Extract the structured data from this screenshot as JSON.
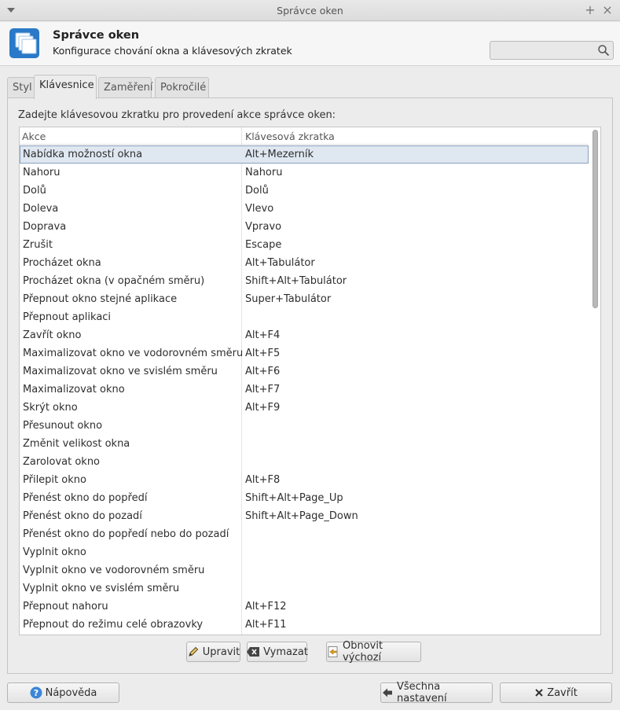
{
  "window": {
    "title": "Správce oken",
    "pin_glyph": "+",
    "close_glyph": "×"
  },
  "header": {
    "title": "Správce oken",
    "subtitle": "Konfigurace chování okna a klávesových zkratek",
    "search_placeholder": ""
  },
  "tabs": [
    {
      "label": "Styl",
      "active": false
    },
    {
      "label": "Klávesnice",
      "active": true
    },
    {
      "label": "Zaměření",
      "active": false
    },
    {
      "label": "Pokročilé",
      "active": false
    }
  ],
  "keyboard": {
    "instruction": "Zadejte klávesovou zkratku pro provedení akce správce oken:",
    "columns": {
      "action": "Akce",
      "shortcut": "Klávesová zkratka"
    },
    "rows": [
      {
        "action": "Nabídka možností okna",
        "shortcut": "Alt+Mezerník",
        "selected": true
      },
      {
        "action": "Nahoru",
        "shortcut": "Nahoru"
      },
      {
        "action": "Dolů",
        "shortcut": "Dolů"
      },
      {
        "action": "Doleva",
        "shortcut": "Vlevo"
      },
      {
        "action": "Doprava",
        "shortcut": "Vpravo"
      },
      {
        "action": "Zrušit",
        "shortcut": "Escape"
      },
      {
        "action": "Procházet okna",
        "shortcut": "Alt+Tabulátor"
      },
      {
        "action": "Procházet okna (v opačném směru)",
        "shortcut": "Shift+Alt+Tabulátor"
      },
      {
        "action": "Přepnout okno stejné aplikace",
        "shortcut": "Super+Tabulátor"
      },
      {
        "action": "Přepnout aplikaci",
        "shortcut": ""
      },
      {
        "action": "Zavřít okno",
        "shortcut": "Alt+F4"
      },
      {
        "action": "Maximalizovat okno ve vodorovném směru",
        "shortcut": "Alt+F5"
      },
      {
        "action": "Maximalizovat okno ve svislém směru",
        "shortcut": "Alt+F6"
      },
      {
        "action": "Maximalizovat okno",
        "shortcut": "Alt+F7"
      },
      {
        "action": "Skrýt okno",
        "shortcut": "Alt+F9"
      },
      {
        "action": "Přesunout okno",
        "shortcut": ""
      },
      {
        "action": "Změnit velikost okna",
        "shortcut": ""
      },
      {
        "action": "Zarolovat okno",
        "shortcut": ""
      },
      {
        "action": "Přilepit okno",
        "shortcut": "Alt+F8"
      },
      {
        "action": "Přenést okno do popředí",
        "shortcut": "Shift+Alt+Page_Up"
      },
      {
        "action": "Přenést okno do pozadí",
        "shortcut": "Shift+Alt+Page_Down"
      },
      {
        "action": "Přenést okno do popředí nebo do pozadí",
        "shortcut": ""
      },
      {
        "action": "Vyplnit okno",
        "shortcut": ""
      },
      {
        "action": "Vyplnit okno ve vodorovném směru",
        "shortcut": ""
      },
      {
        "action": "Vyplnit okno ve svislém směru",
        "shortcut": ""
      },
      {
        "action": "Přepnout nahoru",
        "shortcut": "Alt+F12"
      },
      {
        "action": "Přepnout do režimu celé obrazovky",
        "shortcut": "Alt+F11"
      }
    ],
    "buttons": {
      "edit": "Upravit",
      "clear": "Vymazat",
      "reset": "Obnovit výchozí"
    }
  },
  "footer": {
    "help": "Nápověda",
    "all_settings": "Všechna nastavení",
    "close": "Zavřít"
  },
  "colors": {
    "selection_bg": "#dfe7f1",
    "selection_border": "#8aa1c0",
    "icon_blue": "#2a79c8"
  },
  "icons": {
    "app": "window-manager-icon",
    "search": "search-icon",
    "edit": "pencil-icon",
    "clear": "backspace-icon",
    "reset": "revert-icon",
    "help": "help-icon",
    "back": "arrow-left-icon",
    "close": "close-icon"
  }
}
